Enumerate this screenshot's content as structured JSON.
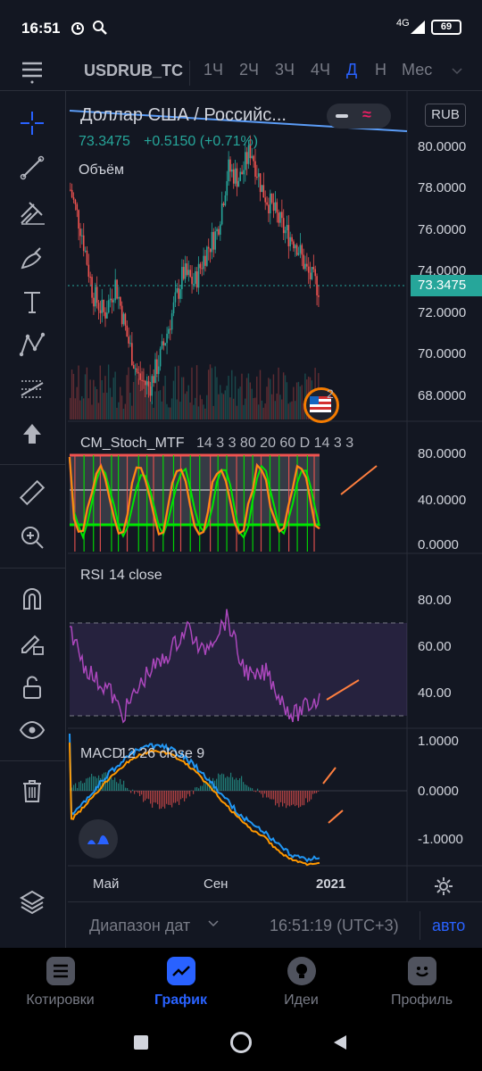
{
  "status_bar": {
    "time": "16:51",
    "network": "4G",
    "battery": "69"
  },
  "toolbar": {
    "symbol": "USDRUB_TC",
    "intervals": [
      "1Ч",
      "2Ч",
      "3Ч",
      "4Ч",
      "Д",
      "Н",
      "Мес"
    ],
    "active_interval": "Д"
  },
  "sidebar": {
    "icons": [
      "menu-icon",
      "crosshair-icon",
      "trend-line-icon",
      "pitchfork-icon",
      "brush-icon",
      "text-icon",
      "pattern-icon",
      "measure-icon",
      "arrow-up-icon",
      "ruler-icon",
      "zoom-in-icon",
      "magnet-icon",
      "lock-pencil-icon",
      "unlock-icon",
      "eye-icon",
      "trash-icon",
      "layers-icon"
    ]
  },
  "chart": {
    "title": "Доллар США / Российс...",
    "price": "73.3475",
    "change": "+0.5150 (+0.71%)",
    "volume_label": "Объём",
    "currency": "RUB",
    "last_price_tag": "73.3475",
    "price_axis": [
      "80.0000",
      "78.0000",
      "76.0000",
      "74.0000",
      "72.0000",
      "70.0000",
      "68.0000"
    ],
    "event_count": "2",
    "colors": {
      "up": "#26a69a",
      "down": "#ef5350",
      "accent": "#2962ff",
      "price_tag": "#26a69a"
    }
  },
  "stoch": {
    "name": "CM_Stoch_MTF",
    "params": "14 3 3 80 20 60 D 14 3 3",
    "axis": [
      "80.0000",
      "40.0000",
      "0.0000"
    ]
  },
  "rsi": {
    "name": "RSI",
    "params": "14 close",
    "axis": [
      "80.00",
      "60.00",
      "40.00"
    ]
  },
  "macd": {
    "name": "MACD",
    "params": "12 26 close 9",
    "axis": [
      "1.0000",
      "0.0000",
      "-1.0000"
    ]
  },
  "time_axis": [
    "Май",
    "Сен",
    "2021"
  ],
  "date_bar": {
    "range_label": "Диапазон дат",
    "clock": "16:51:19 (UTC+3)",
    "auto": "авто"
  },
  "bottom_nav": [
    {
      "label": "Котировки",
      "icon": "list-icon"
    },
    {
      "label": "График",
      "icon": "chart-icon"
    },
    {
      "label": "Идеи",
      "icon": "bulb-icon"
    },
    {
      "label": "Профиль",
      "icon": "smile-icon"
    }
  ],
  "active_nav": "График"
}
